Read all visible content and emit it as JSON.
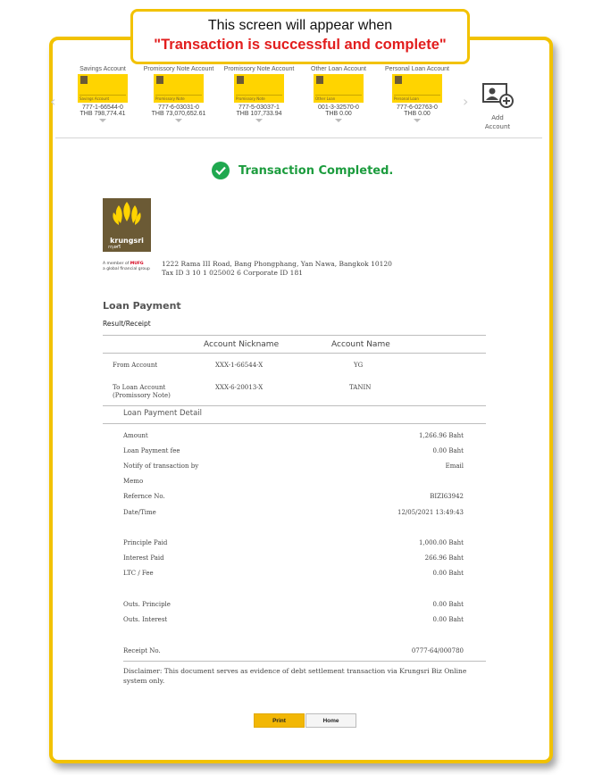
{
  "callout": {
    "line1": "This screen will appear when",
    "line2": "\"Transaction is successful and complete\""
  },
  "accounts": [
    {
      "type": "Savings Account",
      "card_label": "Savings Account",
      "number": "777-1-66544-0",
      "balance": "THB 798,774.41"
    },
    {
      "type": "Promissory Note Account",
      "card_label": "Promissory Note",
      "number": "777-6-03031-0",
      "balance": "THB 73,070,652.61"
    },
    {
      "type": "Promissory Note Account",
      "card_label": "Promissory Note",
      "number": "777-5-03037-1",
      "balance": "THB 107,733.94"
    },
    {
      "type": "Other Loan Account",
      "card_label": "Other Loan",
      "number": "001-3-32570-0",
      "balance": "THB 0.00"
    },
    {
      "type": "Personal Loan Account",
      "card_label": "Personal Loan",
      "number": "777-6-02763-0",
      "balance": "THB 0.00"
    }
  ],
  "add_account": {
    "line1": "Add",
    "line2": "Account"
  },
  "status": {
    "text": "Transaction Completed."
  },
  "bank": {
    "brand": "krungsri",
    "brand_thai": "กรุงศรี",
    "member_line1_a": "A member of ",
    "member_line1_b": "MUFG",
    "member_line2": "a global financial group",
    "address_line1": "1222 Rama III Road, Bang Phongphang, Yan Nawa, Bangkok 10120",
    "address_line2": "Tax ID 3 10 1 025002 6 Corporate ID 181"
  },
  "section": {
    "title": "Loan Payment",
    "subtitle": "Result/Receipt"
  },
  "table": {
    "col_nickname": "Account Nickname",
    "col_name": "Account Name",
    "from_label": "From Account",
    "from_nickname": "XXX-1-66544-X",
    "from_name": "YG",
    "to_label_1": "To Loan Account",
    "to_label_2": "(Promissory Note)",
    "to_nickname": "XXX-6-20013-X",
    "to_name": "TANIN"
  },
  "detail": {
    "heading": "Loan Payment Detail",
    "rows": [
      {
        "label": "Amount",
        "value": "1,266.96 Baht"
      },
      {
        "label": "Loan Payment fee",
        "value": "0.00 Baht"
      },
      {
        "label": "Notify of transaction by",
        "value": "Email"
      },
      {
        "label": "Memo",
        "value": ""
      },
      {
        "label": "Refernce No.",
        "value": "BIZI63942"
      },
      {
        "label": "Date/Time",
        "value": "12/05/2021 13:49:43"
      },
      {
        "label": "Principle Paid",
        "value": "1,000.00 Baht"
      },
      {
        "label": "Interest Paid",
        "value": "266.96 Baht"
      },
      {
        "label": "LTC / Fee",
        "value": "0.00 Baht"
      },
      {
        "label": "Outs. Principle",
        "value": "0.00 Baht"
      },
      {
        "label": "Outs. Interest",
        "value": "0.00 Baht"
      },
      {
        "label": "Receipt No.",
        "value": "0777-64/000780"
      }
    ]
  },
  "disclaimer": "Disclaimer: This document serves as evidence of debt settlement transaction via Krungsri Biz Online system only.",
  "buttons": {
    "print": "Print",
    "home": "Home"
  },
  "colors": {
    "accent": "#f2c200",
    "success": "#1c9c3e",
    "brand_brown": "#6b5a35",
    "alert_red": "#e21d1d"
  }
}
